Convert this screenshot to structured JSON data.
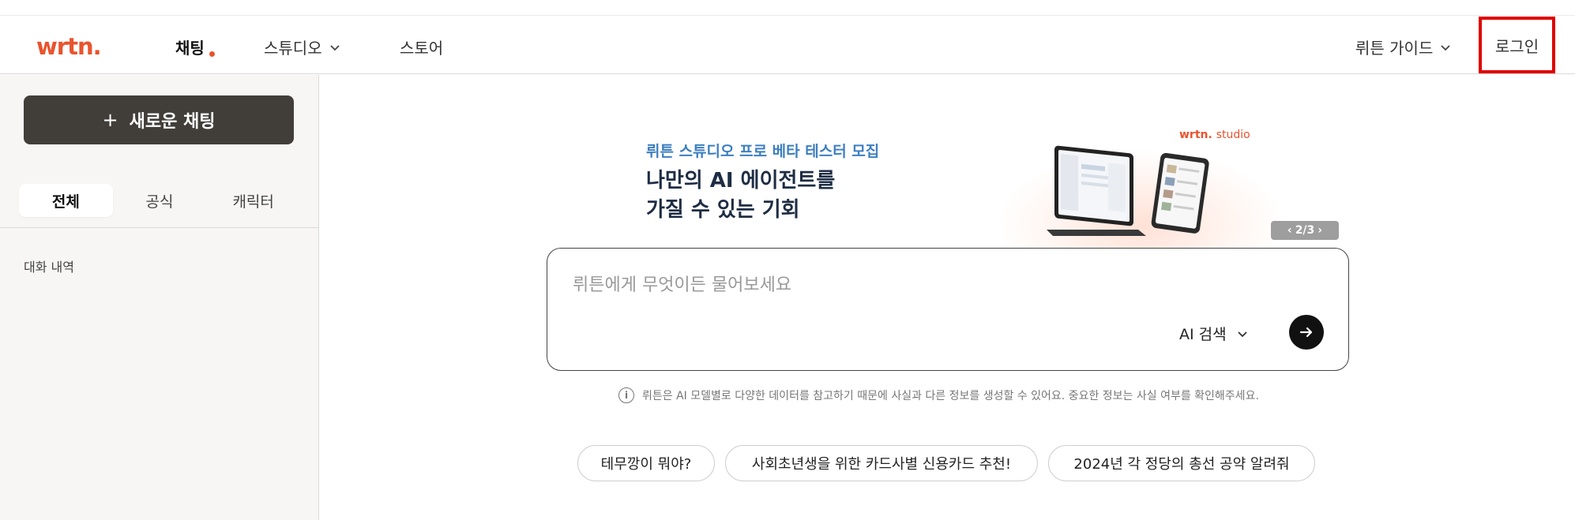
{
  "header": {
    "logo_text": "wrtn",
    "logo_dot": ".",
    "nav": [
      {
        "label": "채팅"
      },
      {
        "label": "스튜디오"
      },
      {
        "label": "스토어"
      }
    ],
    "guide_label": "뤼튼 가이드",
    "login_label": "로그인"
  },
  "sidebar": {
    "new_chat_plus": "+",
    "new_chat_label": "새로운 채팅",
    "tabs": [
      {
        "label": "전체"
      },
      {
        "label": "공식"
      },
      {
        "label": "캐릭터"
      }
    ],
    "history_label": "대화 내역"
  },
  "banner": {
    "subtitle": "뤼튼 스튜디오 프로 베타 테스터 모집",
    "title_line1": "나만의 AI 에이전트를",
    "title_line2": "가질 수 있는 기회",
    "brand": "wrtn.",
    "brand_suffix": "studio",
    "pager_prev": "‹",
    "pager_text": "2/3",
    "pager_next": "›"
  },
  "input": {
    "placeholder": "뤼튼에게 무엇이든 물어보세요",
    "mode_label": "AI 검색"
  },
  "notice": {
    "info_glyph": "i",
    "text": "뤼튼은 AI 모델별로 다양한 데이터를 참고하기 때문에 사실과 다른 정보를 생성할 수 있어요. 중요한 정보는 사실 여부를 확인해주세요."
  },
  "suggestions": [
    {
      "label": "테무깡이 뭐야?"
    },
    {
      "label": "사회초년생을 위한 카드사별 신용카드 추천!"
    },
    {
      "label": "2024년 각 정당의 총선 공약 알려줘"
    }
  ],
  "colors": {
    "brand": "#e8542f",
    "login_highlight": "#e00000",
    "new_chat_bg": "#413e3a",
    "banner_subtitle": "#3c7fc0"
  },
  "icons": [
    "chevron-down-icon",
    "plus-icon",
    "arrow-right-icon",
    "info-icon"
  ]
}
